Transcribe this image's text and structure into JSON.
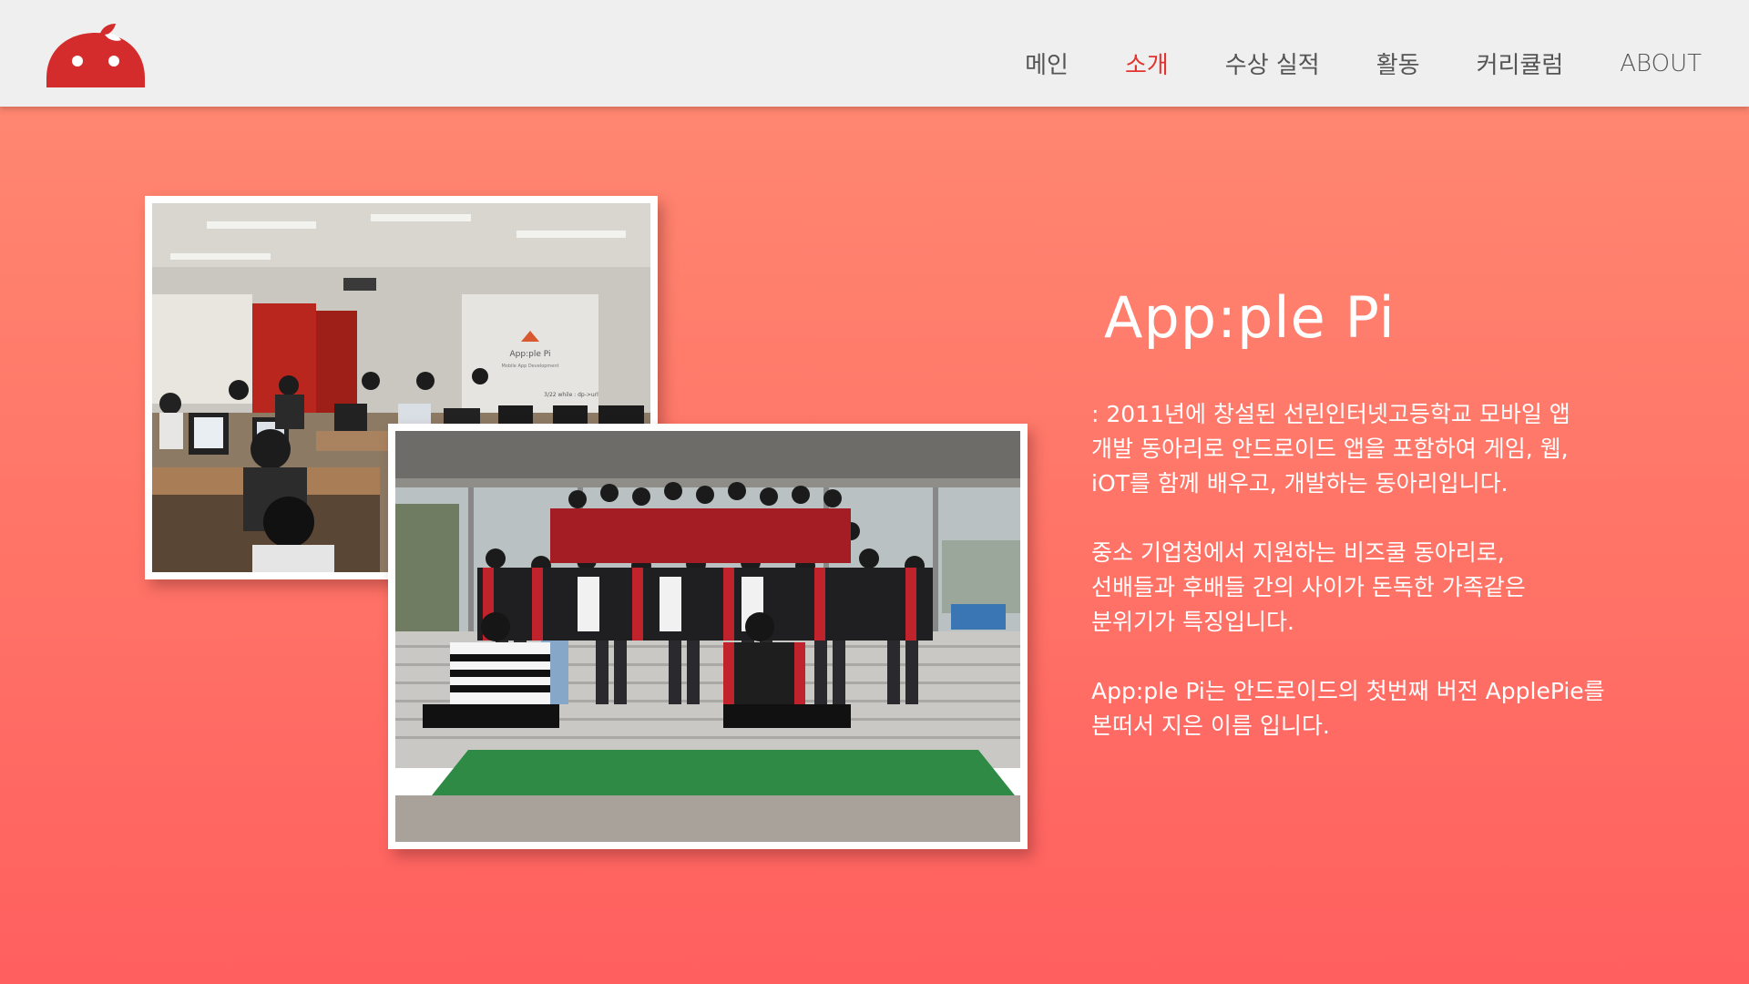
{
  "header": {
    "logo_icon": "apple-pi-logo",
    "nav": [
      {
        "label": "메인",
        "active": false
      },
      {
        "label": "소개",
        "active": true
      },
      {
        "label": "수상 실적",
        "active": false
      },
      {
        "label": "활동",
        "active": false
      },
      {
        "label": "커리큘럼",
        "active": false
      },
      {
        "label": "ABOUT",
        "active": false
      }
    ]
  },
  "photos": {
    "classroom": {
      "screen_title": "App:ple Pi",
      "screen_subtitle": "Mobile App Development",
      "screen_footer": "3/22 while : dp->url"
    },
    "group": {}
  },
  "intro": {
    "title": "App:ple Pi",
    "paragraphs": [
      [
        ": 2011년에 창설된 선린인터넷고등학교 모바일 앱",
        "개발 동아리로 안드로이드 앱을 포함하여 게임, 웹,",
        "iOT를 함께 배우고, 개발하는 동아리입니다."
      ],
      [
        " 중소 기업청에서 지원하는 비즈쿨 동아리로,",
        "선배들과 후배들 간의 사이가 돈독한 가족같은",
        "분위기가 특징입니다."
      ],
      [
        " App:ple Pi는 안드로이드의 첫번째 버전 ApplePie를",
        "본떠서 지은 이름 입니다."
      ]
    ]
  },
  "colors": {
    "header_bg": "#efefef",
    "accent": "#e2332f",
    "nav_text": "#555555",
    "bg_top": "#ff8b73",
    "bg_bottom": "#ff5f5f",
    "text_white": "#ffffff"
  }
}
